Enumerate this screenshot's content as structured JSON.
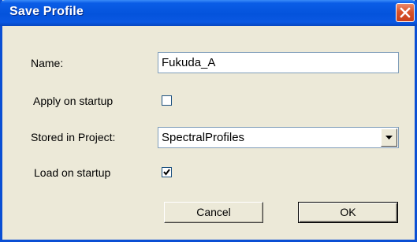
{
  "window": {
    "title": "Save Profile",
    "close_icon": "close-icon"
  },
  "form": {
    "name_label": "Name:",
    "name_value": "Fukuda_A",
    "apply_label": "Apply on startup",
    "apply_checked": false,
    "project_label": "Stored in Project:",
    "project_value": "SpectralProfiles",
    "load_label": "Load on startup",
    "load_checked": true
  },
  "buttons": {
    "cancel_label": "Cancel",
    "ok_label": "OK"
  },
  "colors": {
    "titlebar": "#0453dc",
    "close_button": "#d9532a",
    "dialog_background": "#ece9d8"
  }
}
